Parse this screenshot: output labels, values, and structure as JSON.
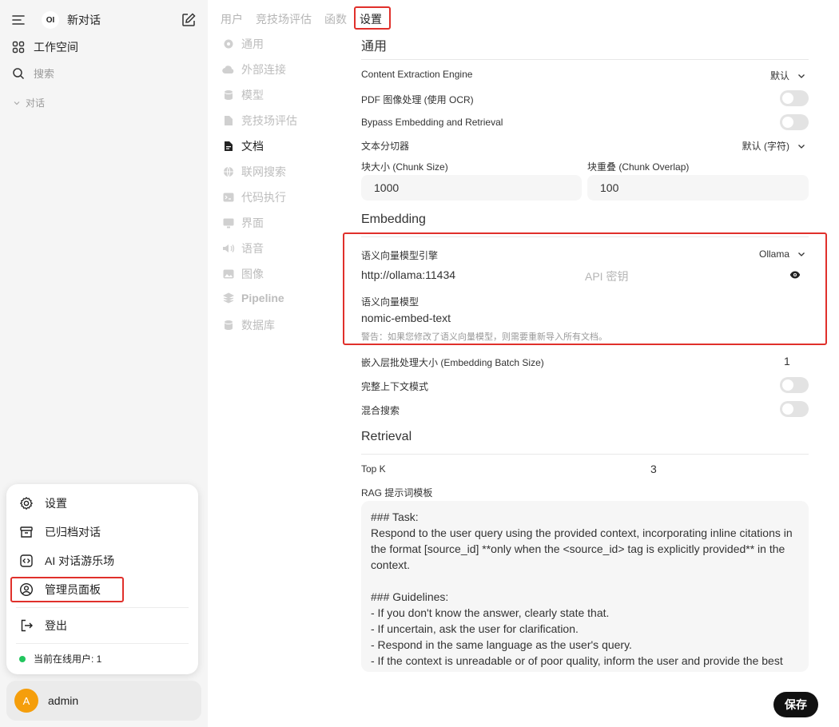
{
  "sidebar": {
    "logo_text": "OI",
    "new_chat": "新对话",
    "workspace": "工作空间",
    "search": "搜索",
    "chats_section": "对话"
  },
  "popup_menu": {
    "items": [
      {
        "label": "设置",
        "icon": "gear-icon"
      },
      {
        "label": "已归档对话",
        "icon": "archive-icon"
      },
      {
        "label": "AI 对话游乐场",
        "icon": "code-icon"
      },
      {
        "label": "管理员面板",
        "icon": "user-circle-icon"
      }
    ],
    "logout": "登出",
    "online_users": "当前在线用户: 1"
  },
  "user": {
    "avatar_letter": "A",
    "name": "admin"
  },
  "top_tabs": [
    "用户",
    "竞技场评估",
    "函数",
    "设置"
  ],
  "settings_nav": [
    {
      "label": "通用",
      "icon": "gear-icon"
    },
    {
      "label": "外部连接",
      "icon": "cloud-icon"
    },
    {
      "label": "模型",
      "icon": "database-icon"
    },
    {
      "label": "竞技场评估",
      "icon": "document-icon"
    },
    {
      "label": "文档",
      "icon": "document-icon"
    },
    {
      "label": "联网搜索",
      "icon": "globe-icon"
    },
    {
      "label": "代码执行",
      "icon": "terminal-icon"
    },
    {
      "label": "界面",
      "icon": "monitor-icon"
    },
    {
      "label": "语音",
      "icon": "speaker-icon"
    },
    {
      "label": "图像",
      "icon": "image-icon"
    },
    {
      "label": "Pipeline",
      "icon": "layers-icon"
    },
    {
      "label": "数据库",
      "icon": "database-icon"
    }
  ],
  "general": {
    "title": "通用",
    "content_extraction_label": "Content Extraction Engine",
    "content_extraction_value": "默认",
    "pdf_ocr_label": "PDF 图像处理 (使用 OCR)",
    "bypass_label": "Bypass Embedding and Retrieval",
    "splitter_label": "文本分切器",
    "splitter_value": "默认 (字符)",
    "chunk_size_label": "块大小 (Chunk Size)",
    "chunk_size_value": "1000",
    "chunk_overlap_label": "块重叠 (Chunk Overlap)",
    "chunk_overlap_value": "100"
  },
  "embedding": {
    "title": "Embedding",
    "engine_label": "语义向量模型引擎",
    "engine_value": "Ollama",
    "url_value": "http://ollama:11434",
    "api_key_placeholder": "API 密钥",
    "model_label": "语义向量模型",
    "model_value": "nomic-embed-text",
    "warning": "警告：如果您修改了语义向量模型，则需要重新导入所有文档。",
    "batch_label": "嵌入层批处理大小 (Embedding Batch Size)",
    "batch_value": "1",
    "full_context_label": "完整上下文模式",
    "hybrid_label": "混合搜索"
  },
  "retrieval": {
    "title": "Retrieval",
    "topk_label": "Top K",
    "topk_value": "3",
    "rag_template_label": "RAG 提示词模板",
    "rag_template_lines": [
      "### Task:",
      "Respond to the user query using the provided context, incorporating inline citations in the format [source_id] **only when the <source_id> tag is explicitly provided** in the context.",
      "",
      "### Guidelines:",
      "- If you don't know the answer, clearly state that.",
      "- If uncertain, ask the user for clarification.",
      "- Respond in the same language as the user's query.",
      "- If the context is unreadable or of poor quality, inform the user and provide the best possible answer."
    ]
  },
  "save_button": "保存",
  "colors": {
    "highlight_red": "#e0302b",
    "online_green": "#22c55e",
    "avatar_orange": "#f59e0b",
    "save_bg": "#111111"
  }
}
